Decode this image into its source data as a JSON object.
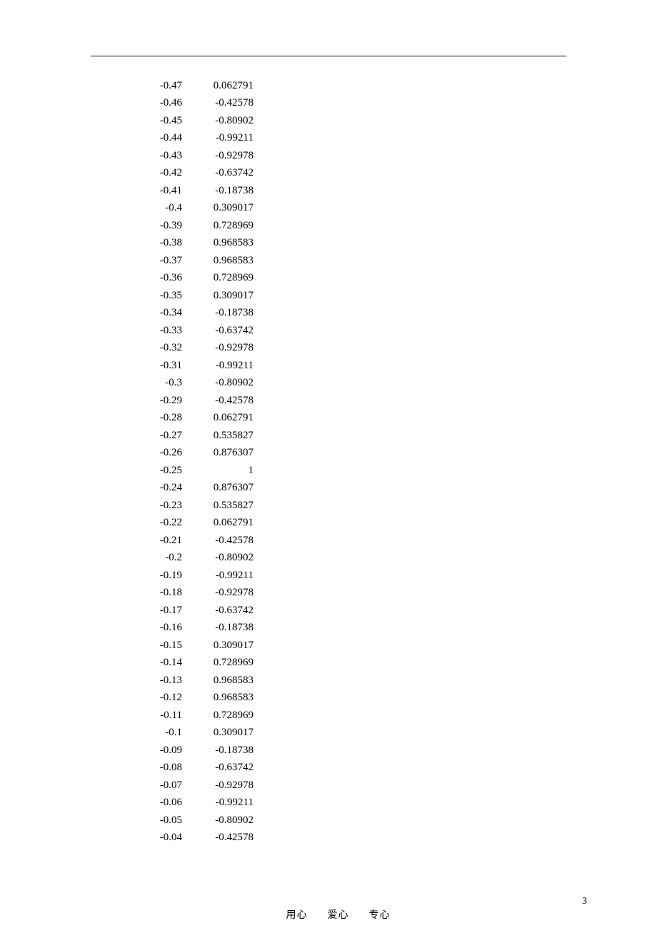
{
  "rows": [
    {
      "a": "-0.47",
      "b": "0.062791"
    },
    {
      "a": "-0.46",
      "b": "-0.42578"
    },
    {
      "a": "-0.45",
      "b": "-0.80902"
    },
    {
      "a": "-0.44",
      "b": "-0.99211"
    },
    {
      "a": "-0.43",
      "b": "-0.92978"
    },
    {
      "a": "-0.42",
      "b": "-0.63742"
    },
    {
      "a": "-0.41",
      "b": "-0.18738"
    },
    {
      "a": "-0.4",
      "b": "0.309017"
    },
    {
      "a": "-0.39",
      "b": "0.728969"
    },
    {
      "a": "-0.38",
      "b": "0.968583"
    },
    {
      "a": "-0.37",
      "b": "0.968583"
    },
    {
      "a": "-0.36",
      "b": "0.728969"
    },
    {
      "a": "-0.35",
      "b": "0.309017"
    },
    {
      "a": "-0.34",
      "b": "-0.18738"
    },
    {
      "a": "-0.33",
      "b": "-0.63742"
    },
    {
      "a": "-0.32",
      "b": "-0.92978"
    },
    {
      "a": "-0.31",
      "b": "-0.99211"
    },
    {
      "a": "-0.3",
      "b": "-0.80902"
    },
    {
      "a": "-0.29",
      "b": "-0.42578"
    },
    {
      "a": "-0.28",
      "b": "0.062791"
    },
    {
      "a": "-0.27",
      "b": "0.535827"
    },
    {
      "a": "-0.26",
      "b": "0.876307"
    },
    {
      "a": "-0.25",
      "b": "1"
    },
    {
      "a": "-0.24",
      "b": "0.876307"
    },
    {
      "a": "-0.23",
      "b": "0.535827"
    },
    {
      "a": "-0.22",
      "b": "0.062791"
    },
    {
      "a": "-0.21",
      "b": "-0.42578"
    },
    {
      "a": "-0.2",
      "b": "-0.80902"
    },
    {
      "a": "-0.19",
      "b": "-0.99211"
    },
    {
      "a": "-0.18",
      "b": "-0.92978"
    },
    {
      "a": "-0.17",
      "b": "-0.63742"
    },
    {
      "a": "-0.16",
      "b": "-0.18738"
    },
    {
      "a": "-0.15",
      "b": "0.309017"
    },
    {
      "a": "-0.14",
      "b": "0.728969"
    },
    {
      "a": "-0.13",
      "b": "0.968583"
    },
    {
      "a": "-0.12",
      "b": "0.968583"
    },
    {
      "a": "-0.11",
      "b": "0.728969"
    },
    {
      "a": "-0.1",
      "b": "0.309017"
    },
    {
      "a": "-0.09",
      "b": "-0.18738"
    },
    {
      "a": "-0.08",
      "b": "-0.63742"
    },
    {
      "a": "-0.07",
      "b": "-0.92978"
    },
    {
      "a": "-0.06",
      "b": "-0.99211"
    },
    {
      "a": "-0.05",
      "b": "-0.80902"
    },
    {
      "a": "-0.04",
      "b": "-0.42578"
    }
  ],
  "footer": {
    "w1": "用心",
    "w2": "爱心",
    "w3": "专心",
    "page": "3"
  }
}
